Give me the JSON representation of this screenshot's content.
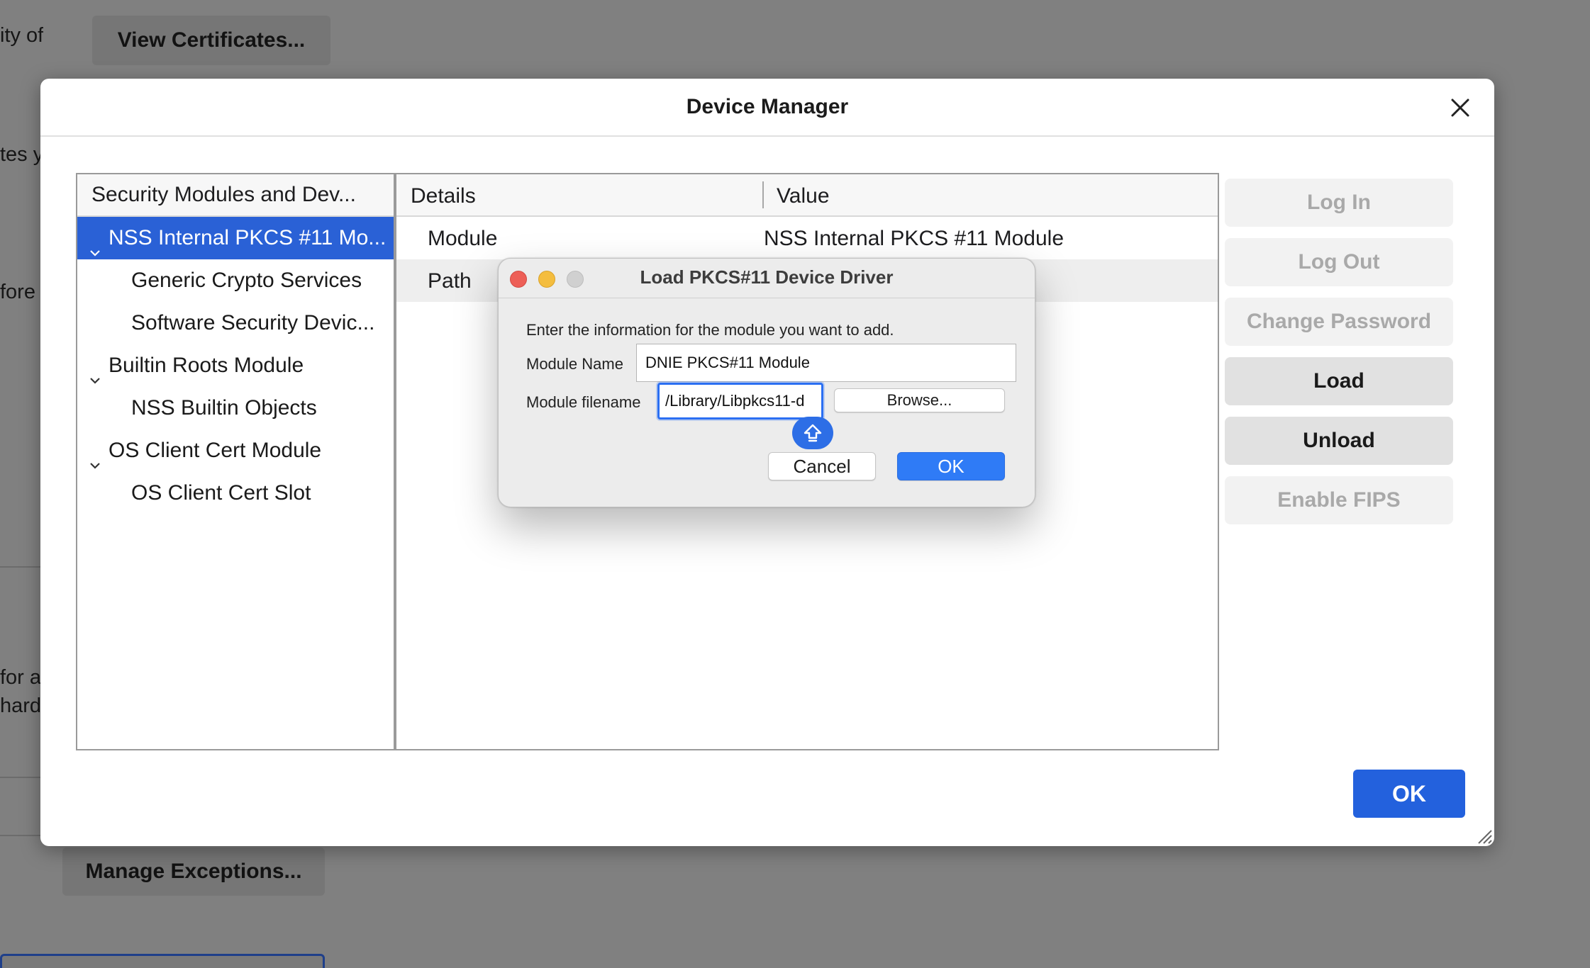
{
  "background": {
    "fragments": [
      "ity of",
      "tes y",
      "fore",
      "for a",
      "harde"
    ],
    "view_certificates_label": "View Certificates...",
    "manage_exceptions_label": "Manage Exceptions..."
  },
  "device_manager": {
    "title": "Device Manager",
    "tree": {
      "header": "Security Modules and Dev...",
      "items": [
        {
          "label": "NSS Internal PKCS #11 Mo...",
          "level": 0,
          "expanded": true,
          "selected": true
        },
        {
          "label": "Generic Crypto Services",
          "level": 1
        },
        {
          "label": "Software Security Devic...",
          "level": 1
        },
        {
          "label": "Builtin Roots Module",
          "level": 0,
          "expanded": true
        },
        {
          "label": "NSS Builtin Objects",
          "level": 1
        },
        {
          "label": "OS Client Cert Module",
          "level": 0,
          "expanded": true
        },
        {
          "label": "OS Client Cert Slot",
          "level": 1
        }
      ]
    },
    "details": {
      "col_details": "Details",
      "col_value": "Value",
      "rows": [
        {
          "key": "Module",
          "value": "NSS Internal PKCS #11 Module"
        },
        {
          "key": "Path",
          "value": ""
        }
      ]
    },
    "buttons": {
      "log_in": "Log In",
      "log_out": "Log Out",
      "change_password": "Change Password",
      "load": "Load",
      "unload": "Unload",
      "enable_fips": "Enable FIPS"
    },
    "ok_label": "OK"
  },
  "load_dialog": {
    "title": "Load PKCS#11 Device Driver",
    "instructions": "Enter the information for the module you want to add.",
    "module_name_label": "Module Name",
    "module_name_value": "DNIE PKCS#11 Module",
    "module_filename_label": "Module filename",
    "module_filename_value": "/Library/Libpkcs11-d",
    "browse_label": "Browse...",
    "cancel_label": "Cancel",
    "ok_label": "OK"
  },
  "colors": {
    "accent": "#2361dd",
    "selection": "#2a61d6",
    "mac_primary": "#2f7bf6"
  }
}
